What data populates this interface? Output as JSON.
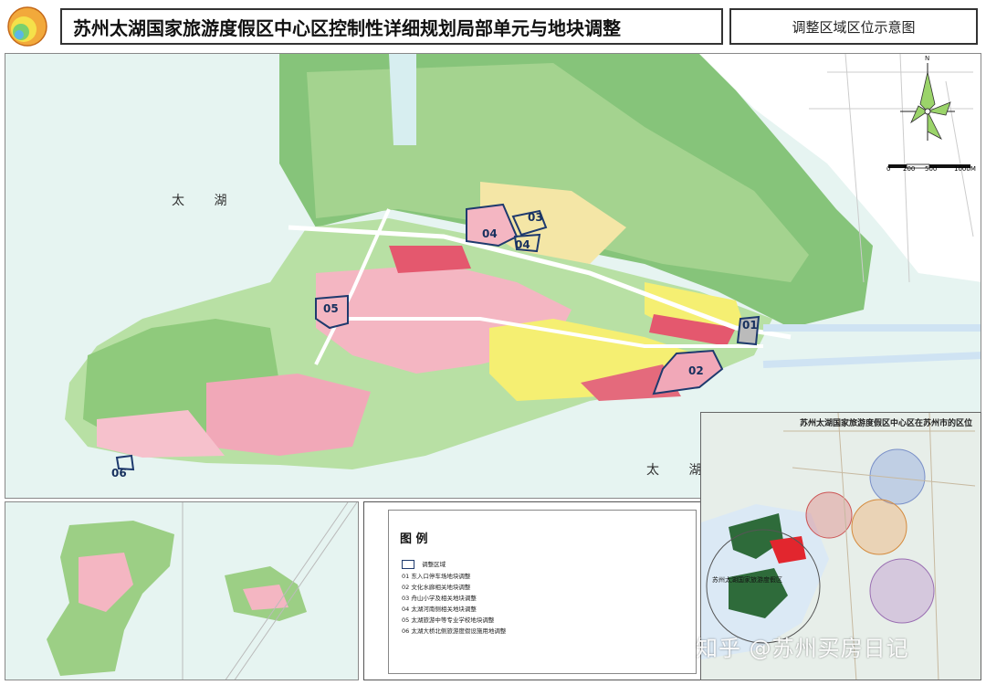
{
  "header": {
    "title": "苏州太湖国家旅游度假区中心区控制性详细规划局部单元与地块调整",
    "subtitle": "调整区域区位示意图"
  },
  "map": {
    "lake_label": "太 湖",
    "lake_label_2": "太 湖",
    "blocks": [
      "01",
      "02",
      "03",
      "04",
      "04",
      "05",
      "06"
    ],
    "scale": {
      "ticks": [
        "0",
        "200",
        "500",
        "1000M"
      ]
    },
    "north": "N"
  },
  "legend": {
    "title": "图 例",
    "items": [
      "调整区域",
      "01 东入口停车场地块调整",
      "02 文化水廊相关地块调整",
      "03 舟山小学及相关地块调整",
      "04 太湖河南侧相关地块调整",
      "05 太湖旅游中等专业学校地块调整",
      "06 太湖大桥北侧旅游度假设施用地调整"
    ]
  },
  "inset": {
    "title": "苏州太湖国家旅游度假区中心区在苏州市的区位",
    "resort_label": "苏州太湖国家旅游度假区"
  },
  "watermark": "知乎 @苏州买房日记",
  "colors": {
    "water": "#e6f4f1",
    "green": "#7cc576",
    "pink": "#f4b6c2",
    "yellow": "#f5ef72",
    "boundary": "#1e3a6e"
  }
}
